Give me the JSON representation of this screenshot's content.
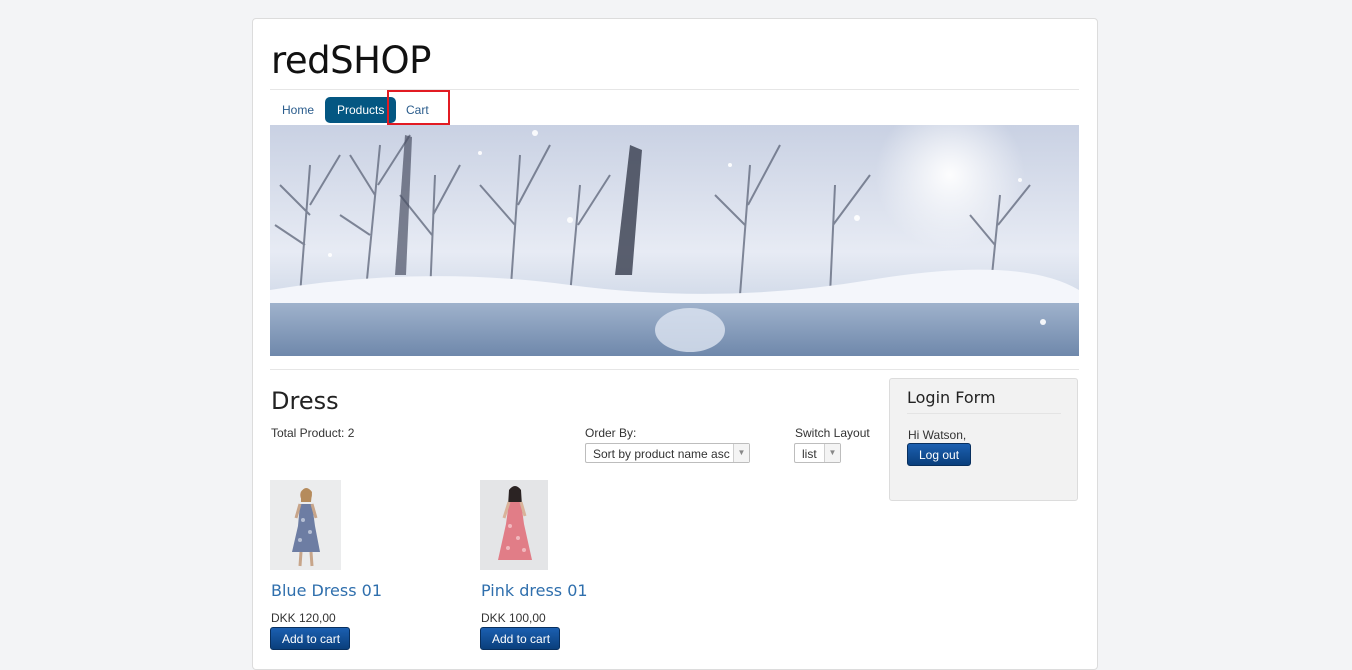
{
  "site": {
    "title": "redSHOP"
  },
  "nav": {
    "items": [
      "Home",
      "Products",
      "Cart"
    ],
    "active": "Products"
  },
  "category": {
    "title": "Dress",
    "total_label": "Total Product: 2",
    "order_by_label": "Order By:",
    "order_by_value": "Sort by product name asc",
    "switch_layout_label": "Switch Layout",
    "switch_layout_value": "list"
  },
  "products": [
    {
      "name": "Blue Dress 01",
      "price": "DKK 120,00",
      "button": "Add to cart"
    },
    {
      "name": "Pink dress 01",
      "price": "DKK 100,00",
      "button": "Add to cart"
    }
  ],
  "login": {
    "title": "Login Form",
    "greeting": "Hi Watson,",
    "logout": "Log out"
  }
}
